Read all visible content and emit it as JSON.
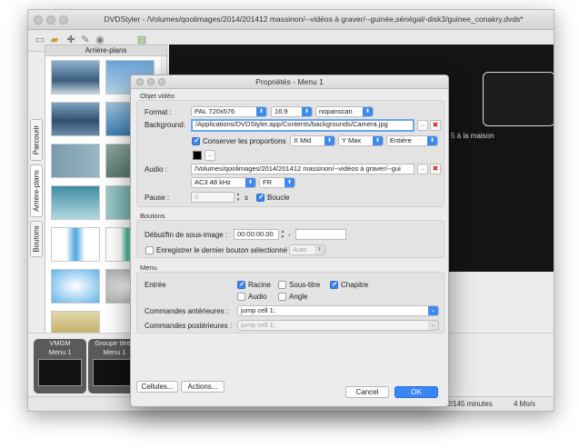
{
  "main_window": {
    "title": "DVDStyler - /Volumes/qoolimages/2014/201412 massinon/--vidéos à graver/--guinée,sénégal/-disk3/guinee_conakry.dvds*",
    "tabs": [
      "Parcourir",
      "Arrière-plans",
      "Boutons"
    ],
    "thumbnails_title": "Arrière-plans",
    "overlay_text": "5 à la maison",
    "titleset": {
      "vmgm_label": "VMGM",
      "vmgm_menu": "Menu 1",
      "group_label": "Groupe titres",
      "group_menu": "Menu 1"
    },
    "status": {
      "duration": "12/145 minutes",
      "rate": "4 Mo/s"
    }
  },
  "dialog": {
    "title": "Propriétés - Menu 1",
    "video": {
      "section": "Objet vidéo",
      "format_label": "Format :",
      "format_value": "PAL 720x576",
      "aspect_value": "16:9",
      "scan_value": "nopanscan",
      "background_label": "Background:",
      "background_value": "/Applications/DVDStyler.app/Contents/backgrounds/Camera.jpg",
      "keep_ratio_label": "Conserver les proportions",
      "keep_ratio_checked": true,
      "align_x": "X Mid",
      "align_y": "Y Max",
      "fit": "Entière",
      "browse_label": "..",
      "color_button_label": "..",
      "audio_label": "Audio :",
      "audio_value": "/Volumes/qoolimages/2014/201412 massinon/--vidéos à graver/--gui",
      "audio_codec": "AC3 48 kHz",
      "audio_lang": "FR",
      "pause_label": "Pause :",
      "pause_value": "0",
      "pause_unit": "s",
      "loop_label": "Boucle",
      "loop_checked": true
    },
    "buttons": {
      "section": "Boutons",
      "subimage_label": "Début/fin de sous-image :",
      "subimage_start": "00:00:00.00",
      "separator": "-",
      "subimage_end": "",
      "save_last_label": "Enregistrer le dernier bouton sélectionné",
      "save_last_checked": false,
      "auto_value": "Auto"
    },
    "menu": {
      "section": "Menu",
      "entry_label": "Entrée",
      "entries": {
        "racine": {
          "label": "Racine",
          "checked": true
        },
        "soustitre": {
          "label": "Sous-titre",
          "checked": false
        },
        "chapitre": {
          "label": "Chapitre",
          "checked": true
        },
        "audio": {
          "label": "Audio",
          "checked": false
        },
        "angle": {
          "label": "Angle",
          "checked": false
        }
      },
      "pre_commands_label": "Commandes antérieures :",
      "pre_commands_value": "jump cell 1;",
      "post_commands_label": "Commandes postérieures :",
      "post_commands_value": "jump cell 1;"
    },
    "footer": {
      "cells_label": "Cellules...",
      "actions_label": "Actions...",
      "cancel_label": "Cancel",
      "ok_label": "OK"
    }
  },
  "colors": {
    "accent": "#3a86f2",
    "delete": "#d02525",
    "window_bg": "#ececec"
  }
}
